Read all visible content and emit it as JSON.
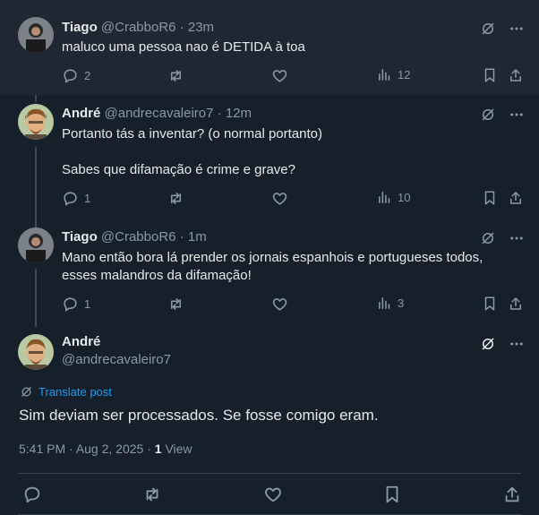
{
  "replies": [
    {
      "name": "Tiago",
      "handle": "@CrabboR6",
      "time": "· 23m",
      "lines": [
        "maluco uma pessoa nao é DETIDA à toa"
      ],
      "replies_count": "2",
      "retweets_count": "",
      "likes_count": "",
      "views_count": "12"
    },
    {
      "name": "André",
      "handle": "@andrecavaleiro7",
      "time": "· 12m",
      "lines": [
        "Portanto tás a inventar? (o normal portanto)",
        "",
        "Sabes que difamação é crime e grave?"
      ],
      "replies_count": "1",
      "retweets_count": "",
      "likes_count": "",
      "views_count": "10"
    },
    {
      "name": "Tiago",
      "handle": "@CrabboR6",
      "time": "· 1m",
      "lines": [
        "Mano então bora lá prender os jornais espanhois e portugueses todos,",
        "esses malandros da difamação!"
      ],
      "replies_count": "1",
      "retweets_count": "",
      "likes_count": "",
      "views_count": "3"
    }
  ],
  "main_post": {
    "name": "André",
    "handle": "@andrecavaleiro7",
    "translate_label": "Translate post",
    "text": "Sim deviam ser processados. Se fosse comigo eram.",
    "timestamp": "5:41 PM · Aug 2, 2025 ·",
    "views_number": "1",
    "views_label": "View"
  },
  "colors": {
    "background": "#15202b",
    "highlight": "#1e2732",
    "text": "#e7e9ea",
    "muted": "#8b98a5",
    "accent": "#1d9bf0"
  },
  "icons": [
    "grok-icon",
    "more-icon",
    "reply-icon",
    "retweet-icon",
    "like-icon",
    "views-icon",
    "bookmark-icon",
    "share-icon",
    "translate-icon"
  ]
}
